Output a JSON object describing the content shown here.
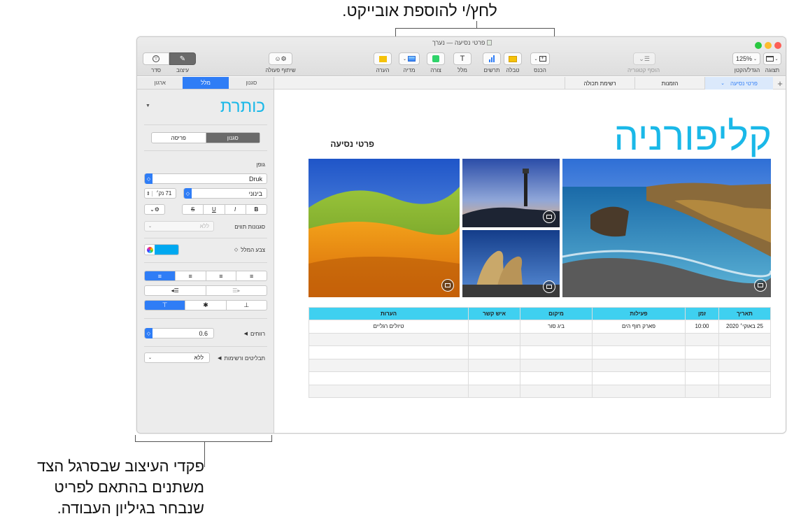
{
  "callouts": {
    "top": "לחץ/י להוספת אובייקט.",
    "bottom_lines": [
      "פקדי העיצוב שבסרגל הצד",
      "משתנים בהתאם לפריט",
      "שנבחר בגיליון העבודה."
    ]
  },
  "window": {
    "title": "פרטי נסיעה — נערך",
    "toolbar": {
      "view": "תצוגה",
      "zoom_value": "125%",
      "zoom_label": "הגדל/הקטן",
      "add_category": "הוסף קטגוריה",
      "insert": "הכנס",
      "table": "טבלה",
      "chart": "תרשים",
      "text": "מלל",
      "shape": "צורה",
      "media": "מדיה",
      "comment": "הערה",
      "collaborate": "שיתוף פעולה",
      "format": "עיצוב",
      "organize": "סדר"
    },
    "tabs": {
      "add": "+",
      "sheet1": "פרטי נסיעה",
      "sheet2": "הזמנות",
      "sheet3": "רשימת תכולה"
    }
  },
  "sidebar": {
    "tabs": [
      "סגנון",
      "מלל",
      "ארגון"
    ],
    "style_title": "כותרת",
    "subtabs": [
      "סגנון",
      "פריסה"
    ],
    "font_label": "גופן",
    "font_name": "Druk",
    "font_weight": "בינוני",
    "font_size": "71 נק׳",
    "bold": "B",
    "italic": "I",
    "underline": "U",
    "strike": "S",
    "char_styles_label": "סגנונות תווים",
    "char_styles_value": "ללא",
    "text_color_label": "צבע המלל",
    "spacing_label": "רווחים",
    "spacing_value": "0.6",
    "bullets_label": "תבליטים ורשימות",
    "bullets_value": "ללא"
  },
  "document": {
    "title": "קליפורניה",
    "subtitle": "פרטי נסיעה",
    "table": {
      "headers": [
        "תאריך",
        "זמן",
        "פעילות",
        "מיקום",
        "איש קשר",
        "הערות"
      ],
      "rows": [
        [
          "25 באוקי׳ 2020",
          "10:00",
          "פארק חוף הים",
          "ביג סור",
          "",
          "טיולים רגליים"
        ],
        [
          "",
          "",
          "",
          "",
          "",
          ""
        ],
        [
          "",
          "",
          "",
          "",
          "",
          ""
        ],
        [
          "",
          "",
          "",
          "",
          "",
          ""
        ],
        [
          "",
          "",
          "",
          "",
          "",
          ""
        ],
        [
          "",
          "",
          "",
          "",
          "",
          ""
        ]
      ]
    }
  },
  "colors": {
    "accent": "#2f7df6",
    "title_cyan": "#1ab8e8",
    "table_header": "#3fd0f0",
    "text_color_swatch": "#00a8f0"
  }
}
